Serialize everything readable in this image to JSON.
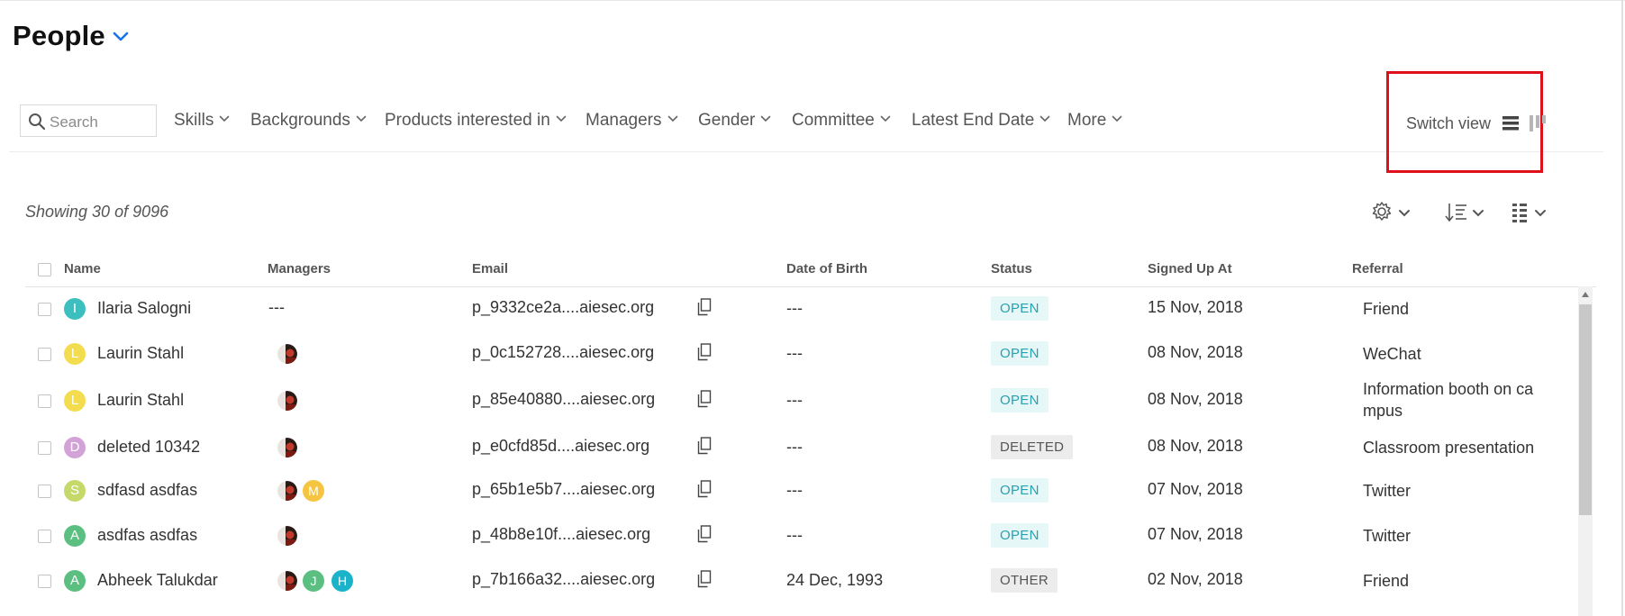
{
  "header": {
    "title": "People"
  },
  "search": {
    "placeholder": "Search"
  },
  "filters": [
    "Skills",
    "Backgrounds",
    "Products interested in",
    "Managers",
    "Gender",
    "Committee",
    "Latest End Date",
    "More"
  ],
  "switch_view": {
    "label": "Switch view"
  },
  "summary": {
    "showing": "Showing 30 of 9096"
  },
  "columns": [
    "Name",
    "Managers",
    "Email",
    "Date of Birth",
    "Status",
    "Signed Up At",
    "Referral"
  ],
  "rows": [
    {
      "initial": "I",
      "color": "#3dbfbf",
      "name": "Ilaria Salogni",
      "managers_text": "---",
      "managers": [],
      "email": "p_9332ce2a....aiesec.org",
      "dob": "---",
      "status": "OPEN",
      "signed_up": "15 Nov, 2018",
      "referral": "Friend"
    },
    {
      "initial": "L",
      "color": "#f3dc4e",
      "name": "Laurin Stahl",
      "managers_text": "",
      "managers": [
        "photo"
      ],
      "email": "p_0c152728....aiesec.org",
      "dob": "---",
      "status": "OPEN",
      "signed_up": "08 Nov, 2018",
      "referral": "WeChat"
    },
    {
      "initial": "L",
      "color": "#f3dc4e",
      "name": "Laurin Stahl",
      "managers_text": "",
      "managers": [
        "photo"
      ],
      "email": "p_85e40880....aiesec.org",
      "dob": "---",
      "status": "OPEN",
      "signed_up": "08 Nov, 2018",
      "referral": "Information booth on ca mpus"
    },
    {
      "initial": "D",
      "color": "#d3a3d8",
      "name": "deleted 10342",
      "managers_text": "",
      "managers": [
        "photo"
      ],
      "email": "p_e0cfd85d....aiesec.org",
      "dob": "---",
      "status": "DELETED",
      "signed_up": "08 Nov, 2018",
      "referral": "Classroom presentation"
    },
    {
      "initial": "S",
      "color": "#c5d96a",
      "name": "sdfasd asdfas",
      "managers_text": "",
      "managers": [
        "photo",
        "M"
      ],
      "email": "p_65b1e5b7....aiesec.org",
      "dob": "---",
      "status": "OPEN",
      "signed_up": "07 Nov, 2018",
      "referral": "Twitter"
    },
    {
      "initial": "A",
      "color": "#5cbf82",
      "name": "asdfas asdfas",
      "managers_text": "",
      "managers": [
        "photo"
      ],
      "email": "p_48b8e10f....aiesec.org",
      "dob": "---",
      "status": "OPEN",
      "signed_up": "07 Nov, 2018",
      "referral": "Twitter"
    },
    {
      "initial": "A",
      "color": "#5cbf82",
      "name": "Abheek Talukdar",
      "managers_text": "",
      "managers": [
        "photo",
        "J",
        "H"
      ],
      "email": "p_7b166a32....aiesec.org",
      "dob": "24 Dec, 1993",
      "status": "OTHER",
      "signed_up": "02 Nov, 2018",
      "referral": "Friend"
    }
  ],
  "manager_colors": {
    "M": "#f5c542",
    "J": "#5cbf82",
    "H": "#1ab3c9"
  },
  "colors": {
    "accent": "#1a73e8",
    "highlight_border": "#e0101a",
    "status_open_text": "#2a9fb0"
  }
}
